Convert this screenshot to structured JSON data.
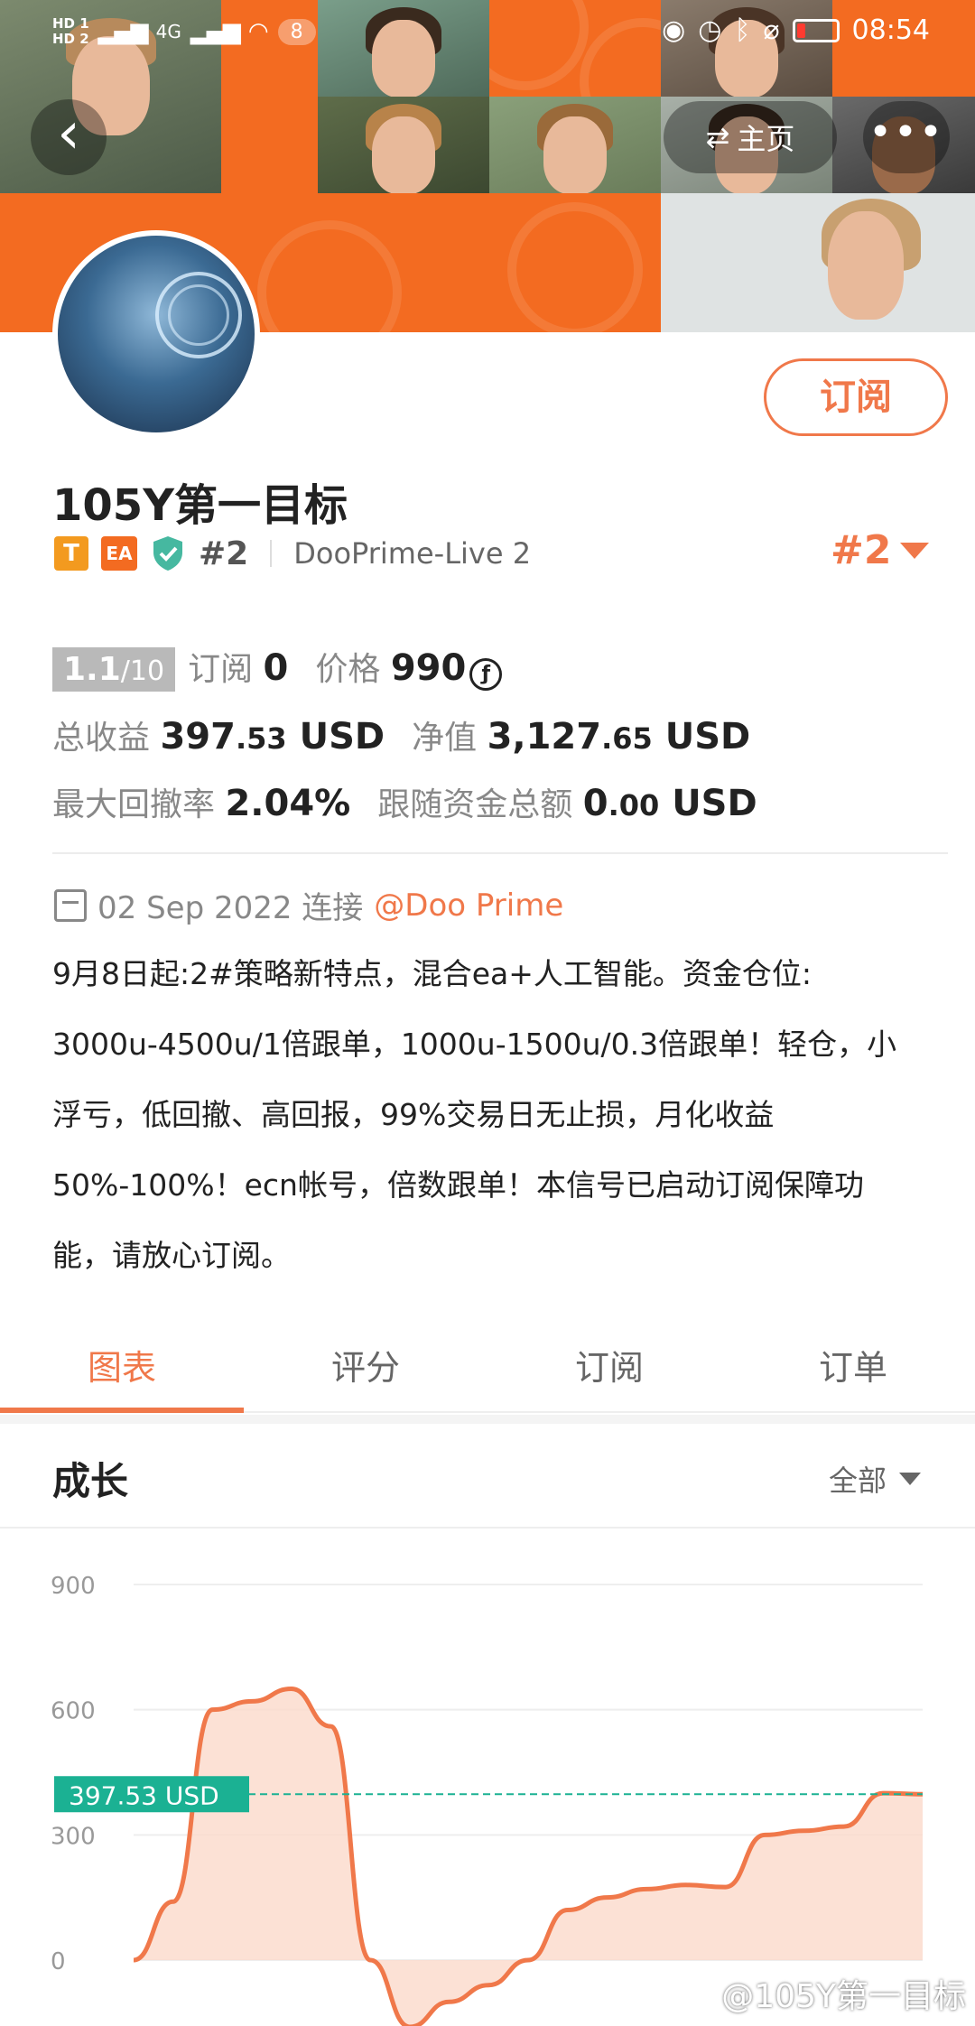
{
  "status_bar": {
    "hd1": "HD 1",
    "hd2": "HD 2",
    "network": "4G",
    "notifications": "8",
    "time": "08:54"
  },
  "header": {
    "back_icon": "chevron-left-icon",
    "home_label": "主页",
    "more_label": "•••"
  },
  "profile": {
    "subscribe_label": "订阅",
    "name": "105Y第一目标",
    "badge_t": "T",
    "badge_ea": "EA",
    "rank": "#2",
    "server": "DooPrime-Live 2",
    "rank_right": "#2"
  },
  "stats": {
    "score": "1.1",
    "score_max": "/10",
    "subscribe_label": "订阅",
    "subscribe_count": "0",
    "price_label": "价格",
    "price_value": "990",
    "coin_symbol": "ƒ",
    "total_profit_label": "总收益",
    "total_profit_int": "397",
    "total_profit_dec": ".53",
    "total_profit_unit": "USD",
    "equity_label": "净值",
    "equity_int": "3,127",
    "equity_dec": ".65",
    "equity_unit": "USD",
    "drawdown_label": "最大回撤率",
    "drawdown_value": "2.04%",
    "follow_label": "跟随资金总额",
    "follow_int": "0",
    "follow_dec": ".00",
    "follow_unit": "USD"
  },
  "connection": {
    "date": "02 Sep 2022 连接",
    "broker": "@Doo Prime"
  },
  "description": {
    "line1": "9月8日起:2#策略新特点，混合ea+人工智能。资金仓位:",
    "line2": "3000u-4500u/1倍跟单，1000u-1500u/0.3倍跟单！轻仓，小",
    "line3": "浮亏，低回撤、高回报，99%交易日无止损，月化收益",
    "line4": "50%-100%！ecn帐号，倍数跟单！本信号已启动订阅保障功",
    "line5": "能，请放心订阅。"
  },
  "tabs": [
    {
      "label": "图表",
      "active": true
    },
    {
      "label": "评分",
      "active": false
    },
    {
      "label": "订阅",
      "active": false
    },
    {
      "label": "订单",
      "active": false
    }
  ],
  "growth": {
    "title": "成长",
    "filter": "全部"
  },
  "chart_data": {
    "type": "area",
    "title": "",
    "xlabel": "",
    "ylabel": "",
    "ylim": [
      0,
      900
    ],
    "y_ticks": [
      "900",
      "600",
      "300",
      "0"
    ],
    "grid": true,
    "current_value_label": "397.53 USD",
    "current_value": 397.53,
    "series": [
      {
        "values": [
          0,
          140,
          600,
          620,
          650,
          560,
          0,
          -160,
          -100,
          -60,
          0,
          120,
          150,
          170,
          180,
          175,
          300,
          310,
          320,
          400,
          397.53
        ]
      }
    ],
    "colors": {
      "line": "#f0784a",
      "fill": "#fbd9cb",
      "marker": "#1bb193"
    }
  },
  "watermark": "@105Y第一目标"
}
